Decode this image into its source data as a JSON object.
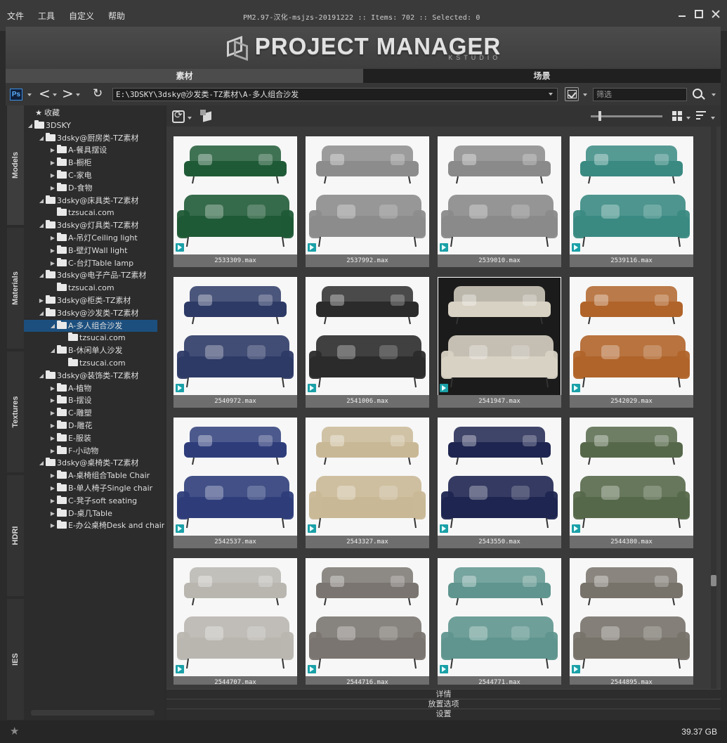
{
  "menu": [
    "文件",
    "工具",
    "自定义",
    "帮助"
  ],
  "window_title": "PM2.97-汉化-msjzs-20191222  :: Items: 702  :: Selected: 0",
  "logo": {
    "title": "PROJECT MANAGER",
    "subtitle": "KSTUDIO"
  },
  "top_tabs": {
    "assets": "素材",
    "scenes": "场景"
  },
  "toolbar": {
    "ps_label": "Ps",
    "path": "E:\\3DSKY\\3dsky@沙发类-TZ素材\\A-多人组合沙发",
    "search_placeholder": "筛选"
  },
  "side_tabs": [
    "Models",
    "Materials",
    "Textures",
    "HDRI",
    "IES"
  ],
  "tree": [
    {
      "label": "收藏",
      "level": 0,
      "type": "favorites",
      "toggle": ""
    },
    {
      "label": "3DSKY",
      "level": 0,
      "type": "folder-open",
      "toggle": "◢"
    },
    {
      "label": "3dsky@厨房类-TZ素材",
      "level": 1,
      "type": "folder",
      "toggle": "◢"
    },
    {
      "label": "A-餐具摆设",
      "level": 2,
      "type": "folder",
      "toggle": "▶"
    },
    {
      "label": "B-橱柜",
      "level": 2,
      "type": "folder",
      "toggle": "▶"
    },
    {
      "label": "C-家电",
      "level": 2,
      "type": "folder",
      "toggle": "▶"
    },
    {
      "label": "D-食物",
      "level": 2,
      "type": "folder",
      "toggle": "▶"
    },
    {
      "label": "3dsky@床具类-TZ素材",
      "level": 1,
      "type": "folder",
      "toggle": "◢"
    },
    {
      "label": "tzsucai.com",
      "level": 2,
      "type": "folder",
      "toggle": ""
    },
    {
      "label": "3dsky@灯具类-TZ素材",
      "level": 1,
      "type": "folder",
      "toggle": "◢"
    },
    {
      "label": "A-吊灯Ceiling light",
      "level": 2,
      "type": "folder",
      "toggle": "▶"
    },
    {
      "label": "B-壁灯Wall light",
      "level": 2,
      "type": "folder",
      "toggle": "▶"
    },
    {
      "label": "C-台灯Table lamp",
      "level": 2,
      "type": "folder",
      "toggle": "▶"
    },
    {
      "label": "3dsky@电子产品-TZ素材",
      "level": 1,
      "type": "folder",
      "toggle": "◢"
    },
    {
      "label": "tzsucai.com",
      "level": 2,
      "type": "folder",
      "toggle": ""
    },
    {
      "label": "3dsky@柜类-TZ素材",
      "level": 1,
      "type": "folder",
      "toggle": "▶"
    },
    {
      "label": "3dsky@沙发类-TZ素材",
      "level": 1,
      "type": "folder",
      "toggle": "◢"
    },
    {
      "label": "A-多人组合沙发",
      "level": 2,
      "type": "folder",
      "toggle": "◢",
      "selected": true
    },
    {
      "label": "tzsucai.com",
      "level": 3,
      "type": "folder",
      "toggle": ""
    },
    {
      "label": "B-休闲单人沙发",
      "level": 2,
      "type": "folder",
      "toggle": "◢"
    },
    {
      "label": "tzsucai.com",
      "level": 3,
      "type": "folder",
      "toggle": ""
    },
    {
      "label": "3dsky@装饰类-TZ素材",
      "level": 1,
      "type": "folder",
      "toggle": "◢"
    },
    {
      "label": "A-植物",
      "level": 2,
      "type": "folder",
      "toggle": "▶"
    },
    {
      "label": "B-摆设",
      "level": 2,
      "type": "folder",
      "toggle": "▶"
    },
    {
      "label": "C-雕塑",
      "level": 2,
      "type": "folder",
      "toggle": "▶"
    },
    {
      "label": "D-雕花",
      "level": 2,
      "type": "folder",
      "toggle": "▶"
    },
    {
      "label": "E-服装",
      "level": 2,
      "type": "folder",
      "toggle": "▶"
    },
    {
      "label": "F-小动物",
      "level": 2,
      "type": "folder",
      "toggle": "▶"
    },
    {
      "label": "3dsky@桌椅类-TZ素材",
      "level": 1,
      "type": "folder",
      "toggle": "◢"
    },
    {
      "label": "A-桌椅组合Table Chair",
      "level": 2,
      "type": "folder",
      "toggle": "▶"
    },
    {
      "label": "B-单人椅子Single chair",
      "level": 2,
      "type": "folder",
      "toggle": "▶"
    },
    {
      "label": "C-凳子soft seating",
      "level": 2,
      "type": "folder",
      "toggle": "▶"
    },
    {
      "label": "D-桌几Table",
      "level": 2,
      "type": "folder",
      "toggle": "▶"
    },
    {
      "label": "E-办公桌椅Desk and chair",
      "level": 2,
      "type": "folder",
      "toggle": "▶"
    }
  ],
  "items": [
    {
      "name": "2533309.max",
      "color": "#1f5a36",
      "dark": false
    },
    {
      "name": "2537992.max",
      "color": "#8c8c8c",
      "dark": false
    },
    {
      "name": "2539010.max",
      "color": "#8a8a8a",
      "dark": false
    },
    {
      "name": "2539116.max",
      "color": "#3a8a82",
      "dark": false
    },
    {
      "name": "2540972.max",
      "color": "#2d3a66",
      "dark": false
    },
    {
      "name": "2541006.max",
      "color": "#2b2b2b",
      "dark": false
    },
    {
      "name": "2541947.max",
      "color": "#d8d2c4",
      "dark": true
    },
    {
      "name": "2542029.max",
      "color": "#b0642a",
      "dark": false
    },
    {
      "name": "2542537.max",
      "color": "#2e3d7a",
      "dark": false
    },
    {
      "name": "2543327.max",
      "color": "#c9b896",
      "dark": false
    },
    {
      "name": "2543550.max",
      "color": "#1e2550",
      "dark": false
    },
    {
      "name": "2544380.max",
      "color": "#56684a",
      "dark": false
    },
    {
      "name": "2544707.max",
      "color": "#b9b6b0",
      "dark": false
    },
    {
      "name": "2544716.max",
      "color": "#7a7570",
      "dark": false
    },
    {
      "name": "2544771.max",
      "color": "#5f958e",
      "dark": false
    },
    {
      "name": "2544895.max",
      "color": "#77726a",
      "dark": false
    }
  ],
  "bottom_panels": {
    "details": "详情",
    "placement": "放置选项",
    "settings": "设置"
  },
  "status": {
    "disk_free": "39.37 GB"
  },
  "icons": {
    "ps": "photoshop-icon",
    "back": "back-arrow-icon",
    "forward": "forward-arrow-icon",
    "refresh": "refresh-icon",
    "search": "search-icon",
    "grid": "grid-view-icon",
    "sort": "sort-icon",
    "max_file": "3dsmax-file-icon"
  },
  "colors": {
    "accent": "#1c4f7e",
    "background": "#2b2b2b",
    "panel": "#3a3a3a"
  }
}
